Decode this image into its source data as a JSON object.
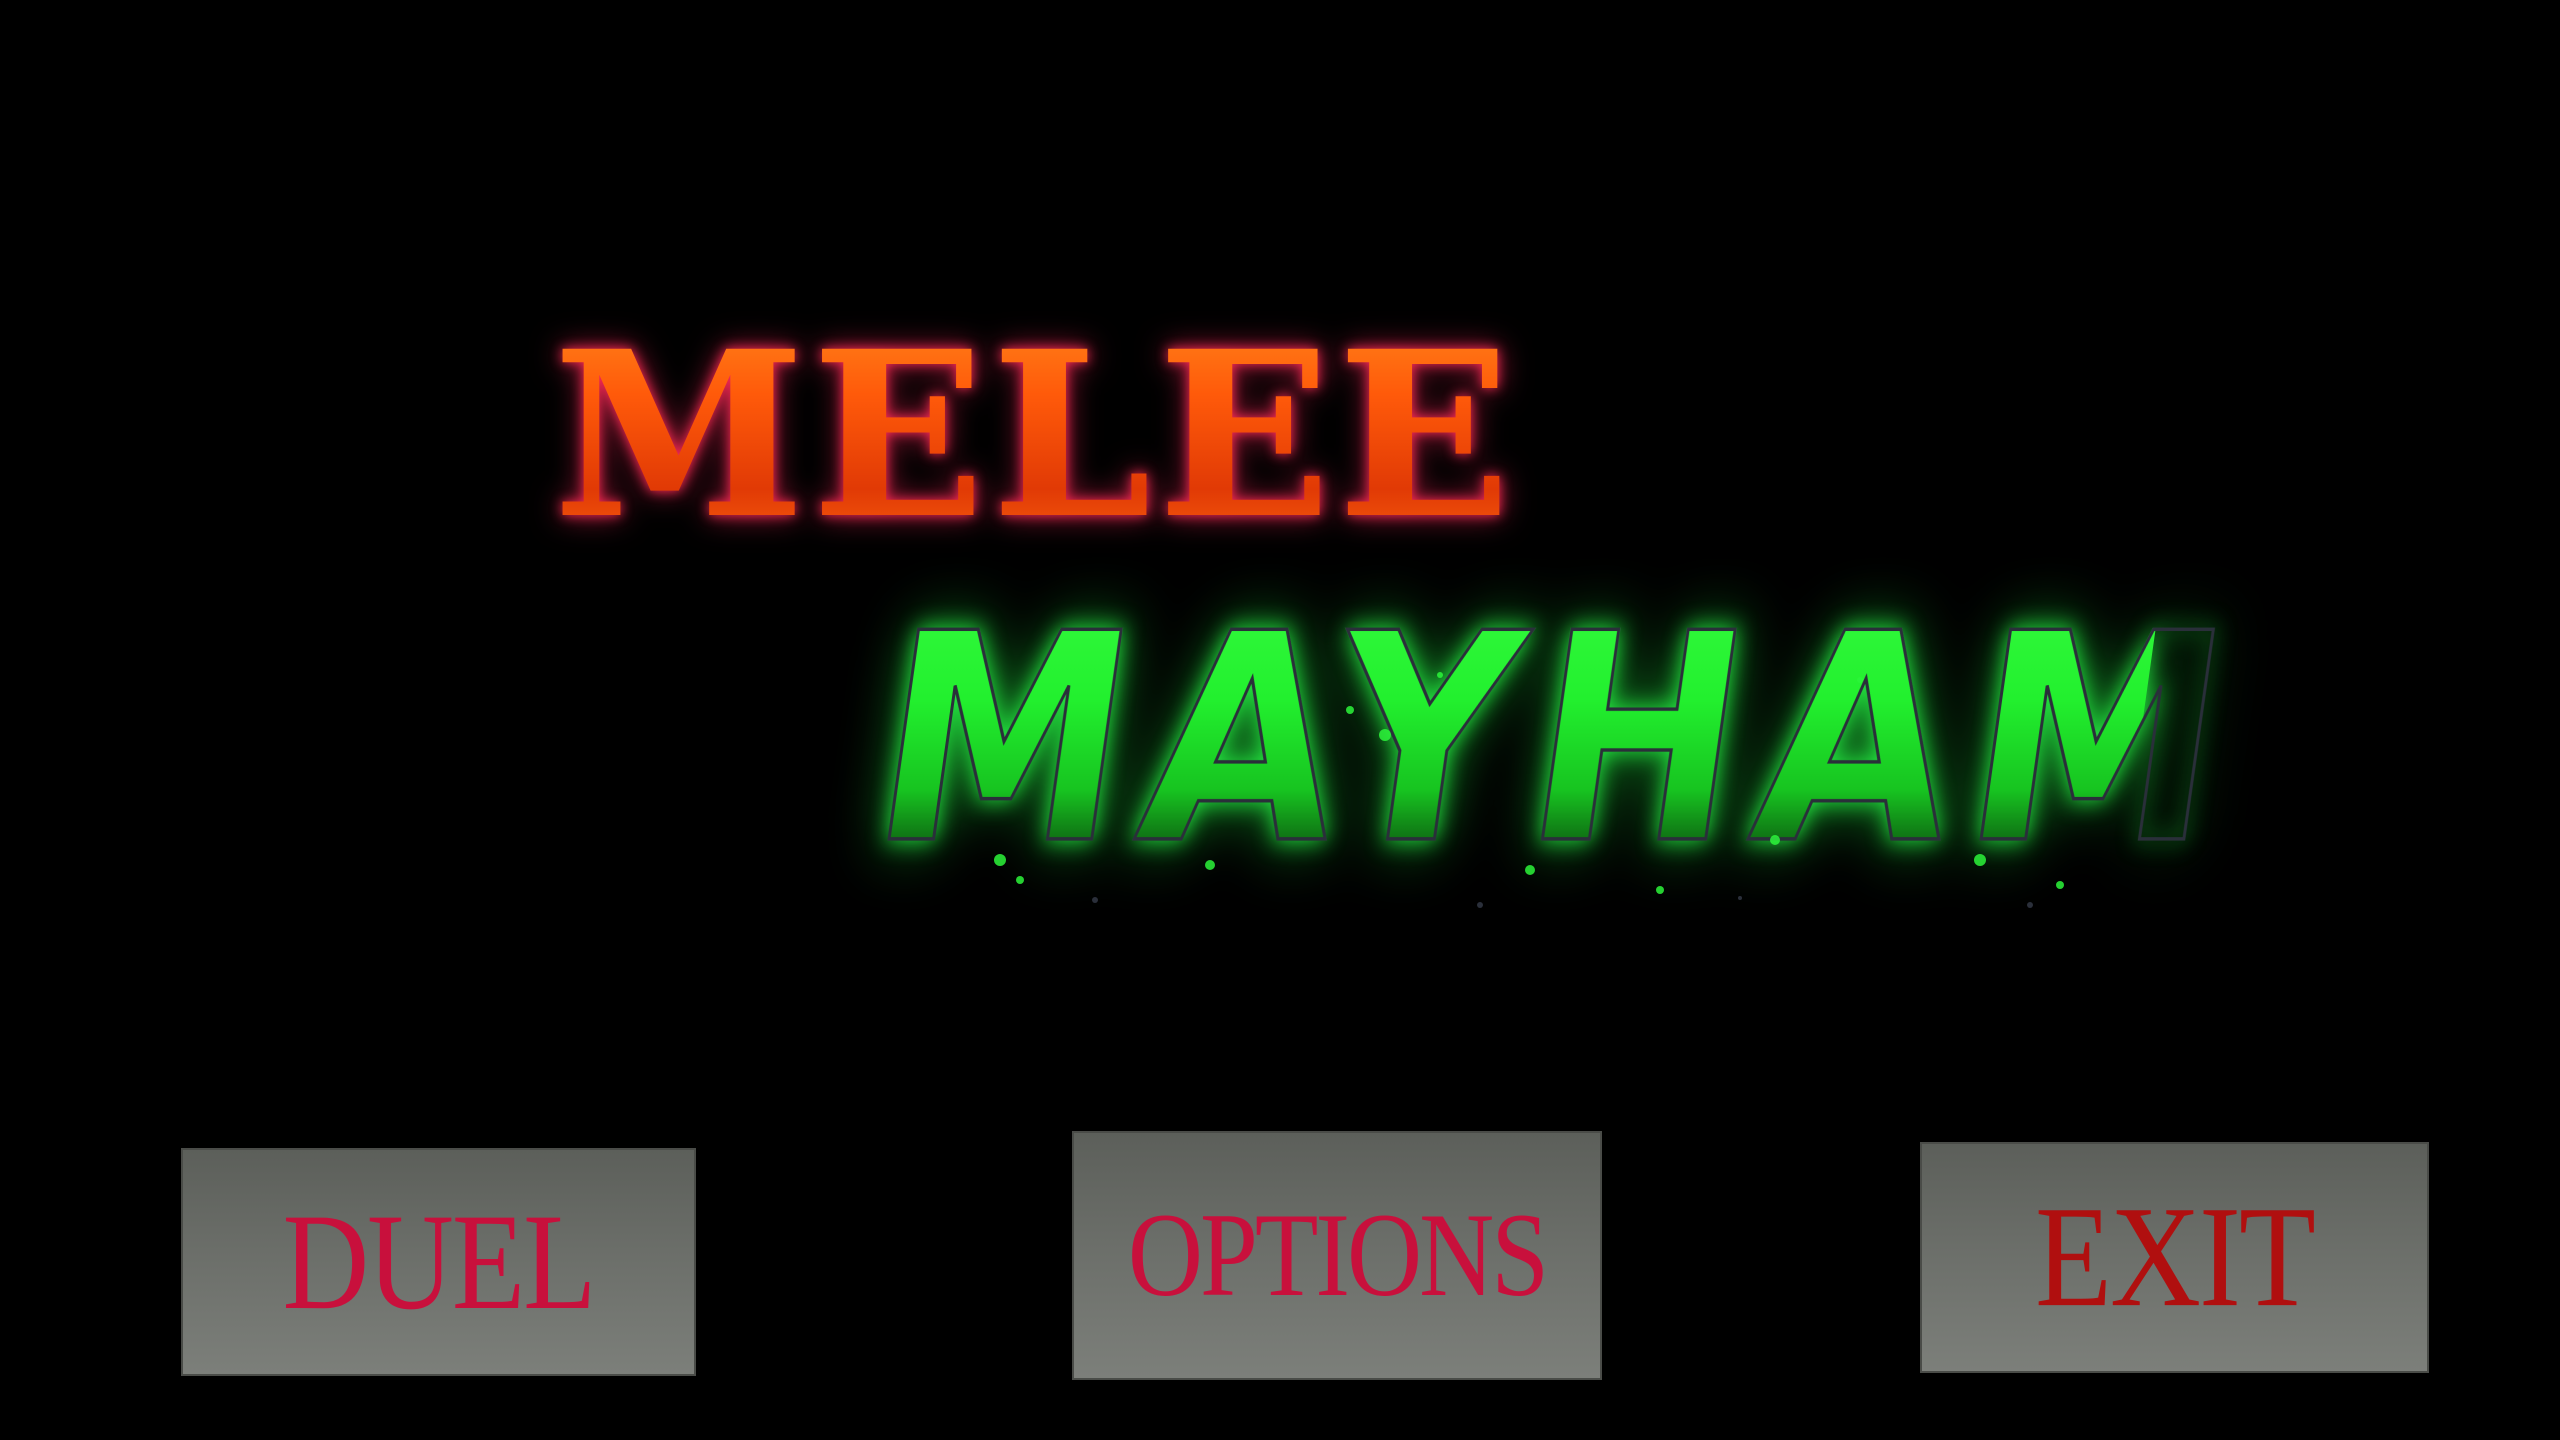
{
  "title": {
    "line1": "MELEE",
    "line2": "MAYHAM"
  },
  "menu": {
    "duel_label": "DUEL",
    "options_label": "OPTIONS",
    "exit_label": "EXIT"
  },
  "colors": {
    "background": "#000000",
    "title_line1": "#ff5a10",
    "title_line1_glow": "#ff2a55",
    "title_line2": "#22f02e",
    "title_line2_glow": "#28ff46",
    "button_face": "#6b6e69",
    "button_text": "#c8103c",
    "exit_text": "#b00f0f"
  }
}
